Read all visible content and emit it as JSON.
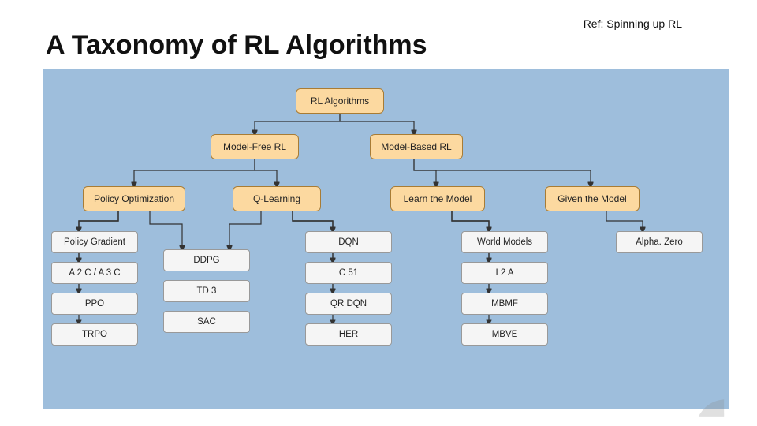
{
  "title": "A Taxonomy of RL Algorithms",
  "ref": "Ref: Spinning up RL",
  "nodes": {
    "root": "RL Algorithms",
    "mf": "Model-Free RL",
    "mb": "Model-Based RL",
    "po": "Policy Optimization",
    "ql": "Q-Learning",
    "lm": "Learn the Model",
    "gm": "Given the Model"
  },
  "leaves": {
    "po1": "Policy Gradient",
    "po2": "A 2 C / A 3 C",
    "po3": "PPO",
    "po4": "TRPO",
    "mid1": "DDPG",
    "mid2": "TD 3",
    "mid3": "SAC",
    "ql1": "DQN",
    "ql2": "C 51",
    "ql3": "QR DQN",
    "ql4": "HER",
    "lm1": "World Models",
    "lm2": "I 2 A",
    "lm3": "MBMF",
    "lm4": "MBVE",
    "gm1": "Alpha. Zero"
  }
}
